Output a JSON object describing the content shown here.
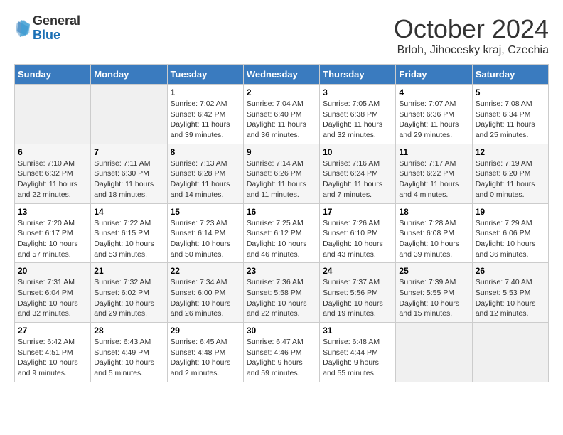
{
  "logo": {
    "general": "General",
    "blue": "Blue"
  },
  "title": "October 2024",
  "location": "Brloh, Jihocesky kraj, Czechia",
  "weekdays": [
    "Sunday",
    "Monday",
    "Tuesday",
    "Wednesday",
    "Thursday",
    "Friday",
    "Saturday"
  ],
  "weeks": [
    [
      {
        "num": "",
        "empty": true
      },
      {
        "num": "",
        "empty": true
      },
      {
        "num": "1",
        "sunrise": "7:02 AM",
        "sunset": "6:42 PM",
        "daylight": "11 hours and 39 minutes."
      },
      {
        "num": "2",
        "sunrise": "7:04 AM",
        "sunset": "6:40 PM",
        "daylight": "11 hours and 36 minutes."
      },
      {
        "num": "3",
        "sunrise": "7:05 AM",
        "sunset": "6:38 PM",
        "daylight": "11 hours and 32 minutes."
      },
      {
        "num": "4",
        "sunrise": "7:07 AM",
        "sunset": "6:36 PM",
        "daylight": "11 hours and 29 minutes."
      },
      {
        "num": "5",
        "sunrise": "7:08 AM",
        "sunset": "6:34 PM",
        "daylight": "11 hours and 25 minutes."
      }
    ],
    [
      {
        "num": "6",
        "sunrise": "7:10 AM",
        "sunset": "6:32 PM",
        "daylight": "11 hours and 22 minutes."
      },
      {
        "num": "7",
        "sunrise": "7:11 AM",
        "sunset": "6:30 PM",
        "daylight": "11 hours and 18 minutes."
      },
      {
        "num": "8",
        "sunrise": "7:13 AM",
        "sunset": "6:28 PM",
        "daylight": "11 hours and 14 minutes."
      },
      {
        "num": "9",
        "sunrise": "7:14 AM",
        "sunset": "6:26 PM",
        "daylight": "11 hours and 11 minutes."
      },
      {
        "num": "10",
        "sunrise": "7:16 AM",
        "sunset": "6:24 PM",
        "daylight": "11 hours and 7 minutes."
      },
      {
        "num": "11",
        "sunrise": "7:17 AM",
        "sunset": "6:22 PM",
        "daylight": "11 hours and 4 minutes."
      },
      {
        "num": "12",
        "sunrise": "7:19 AM",
        "sunset": "6:20 PM",
        "daylight": "11 hours and 0 minutes."
      }
    ],
    [
      {
        "num": "13",
        "sunrise": "7:20 AM",
        "sunset": "6:17 PM",
        "daylight": "10 hours and 57 minutes."
      },
      {
        "num": "14",
        "sunrise": "7:22 AM",
        "sunset": "6:15 PM",
        "daylight": "10 hours and 53 minutes."
      },
      {
        "num": "15",
        "sunrise": "7:23 AM",
        "sunset": "6:14 PM",
        "daylight": "10 hours and 50 minutes."
      },
      {
        "num": "16",
        "sunrise": "7:25 AM",
        "sunset": "6:12 PM",
        "daylight": "10 hours and 46 minutes."
      },
      {
        "num": "17",
        "sunrise": "7:26 AM",
        "sunset": "6:10 PM",
        "daylight": "10 hours and 43 minutes."
      },
      {
        "num": "18",
        "sunrise": "7:28 AM",
        "sunset": "6:08 PM",
        "daylight": "10 hours and 39 minutes."
      },
      {
        "num": "19",
        "sunrise": "7:29 AM",
        "sunset": "6:06 PM",
        "daylight": "10 hours and 36 minutes."
      }
    ],
    [
      {
        "num": "20",
        "sunrise": "7:31 AM",
        "sunset": "6:04 PM",
        "daylight": "10 hours and 32 minutes."
      },
      {
        "num": "21",
        "sunrise": "7:32 AM",
        "sunset": "6:02 PM",
        "daylight": "10 hours and 29 minutes."
      },
      {
        "num": "22",
        "sunrise": "7:34 AM",
        "sunset": "6:00 PM",
        "daylight": "10 hours and 26 minutes."
      },
      {
        "num": "23",
        "sunrise": "7:36 AM",
        "sunset": "5:58 PM",
        "daylight": "10 hours and 22 minutes."
      },
      {
        "num": "24",
        "sunrise": "7:37 AM",
        "sunset": "5:56 PM",
        "daylight": "10 hours and 19 minutes."
      },
      {
        "num": "25",
        "sunrise": "7:39 AM",
        "sunset": "5:55 PM",
        "daylight": "10 hours and 15 minutes."
      },
      {
        "num": "26",
        "sunrise": "7:40 AM",
        "sunset": "5:53 PM",
        "daylight": "10 hours and 12 minutes."
      }
    ],
    [
      {
        "num": "27",
        "sunrise": "6:42 AM",
        "sunset": "4:51 PM",
        "daylight": "10 hours and 9 minutes."
      },
      {
        "num": "28",
        "sunrise": "6:43 AM",
        "sunset": "4:49 PM",
        "daylight": "10 hours and 5 minutes."
      },
      {
        "num": "29",
        "sunrise": "6:45 AM",
        "sunset": "4:48 PM",
        "daylight": "10 hours and 2 minutes."
      },
      {
        "num": "30",
        "sunrise": "6:47 AM",
        "sunset": "4:46 PM",
        "daylight": "9 hours and 59 minutes."
      },
      {
        "num": "31",
        "sunrise": "6:48 AM",
        "sunset": "4:44 PM",
        "daylight": "9 hours and 55 minutes."
      },
      {
        "num": "",
        "empty": true
      },
      {
        "num": "",
        "empty": true
      }
    ]
  ]
}
